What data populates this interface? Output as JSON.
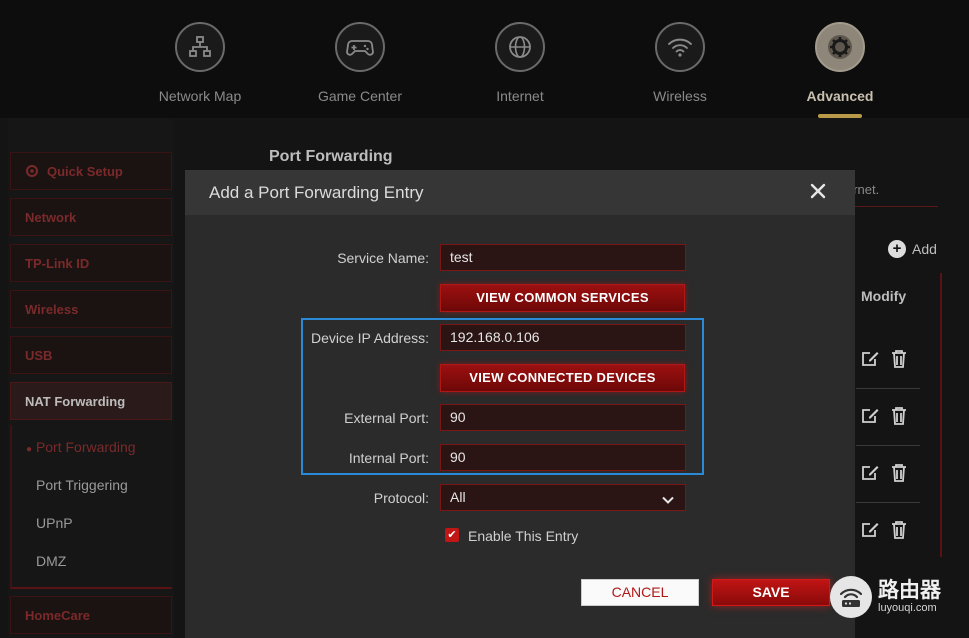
{
  "top_nav": {
    "items": [
      {
        "label": "Network Map",
        "icon": "network-map-icon"
      },
      {
        "label": "Game Center",
        "icon": "gamepad-icon"
      },
      {
        "label": "Internet",
        "icon": "globe-icon"
      },
      {
        "label": "Wireless",
        "icon": "wifi-icon"
      },
      {
        "label": "Advanced",
        "icon": "gear-icon",
        "active": true
      }
    ]
  },
  "sidebar": {
    "items": [
      {
        "label": "Quick Setup"
      },
      {
        "label": "Network"
      },
      {
        "label": "TP-Link ID"
      },
      {
        "label": "Wireless"
      },
      {
        "label": "USB"
      },
      {
        "label": "NAT Forwarding",
        "active": true
      },
      {
        "label": "HomeCare"
      }
    ],
    "sub_items": [
      {
        "label": "Port Forwarding",
        "active": true
      },
      {
        "label": "Port Triggering"
      },
      {
        "label": "UPnP"
      },
      {
        "label": "DMZ"
      }
    ]
  },
  "main": {
    "title": "Port Forwarding",
    "internet_text": "ernet.",
    "add_label": "Add",
    "modify_header": "Modify"
  },
  "modal": {
    "title": "Add a Port Forwarding Entry",
    "service_name_label": "Service Name:",
    "service_name_value": "test",
    "view_common_services": "VIEW COMMON SERVICES",
    "device_ip_label": "Device IP Address:",
    "device_ip_value": "192.168.0.106",
    "view_connected_devices": "VIEW CONNECTED DEVICES",
    "external_port_label": "External Port:",
    "external_port_value": "90",
    "internal_port_label": "Internal Port:",
    "internal_port_value": "90",
    "protocol_label": "Protocol:",
    "protocol_value": "All",
    "enable_entry_label": "Enable This Entry",
    "enable_entry_checked": true,
    "cancel_label": "CANCEL",
    "save_label": "SAVE"
  },
  "watermark": {
    "chinese": "路由器",
    "url": "luyouqi.com"
  },
  "colors": {
    "accent_red": "#c01616",
    "highlight_blue": "#2b8ad8",
    "active_gold": "#b89a48"
  }
}
